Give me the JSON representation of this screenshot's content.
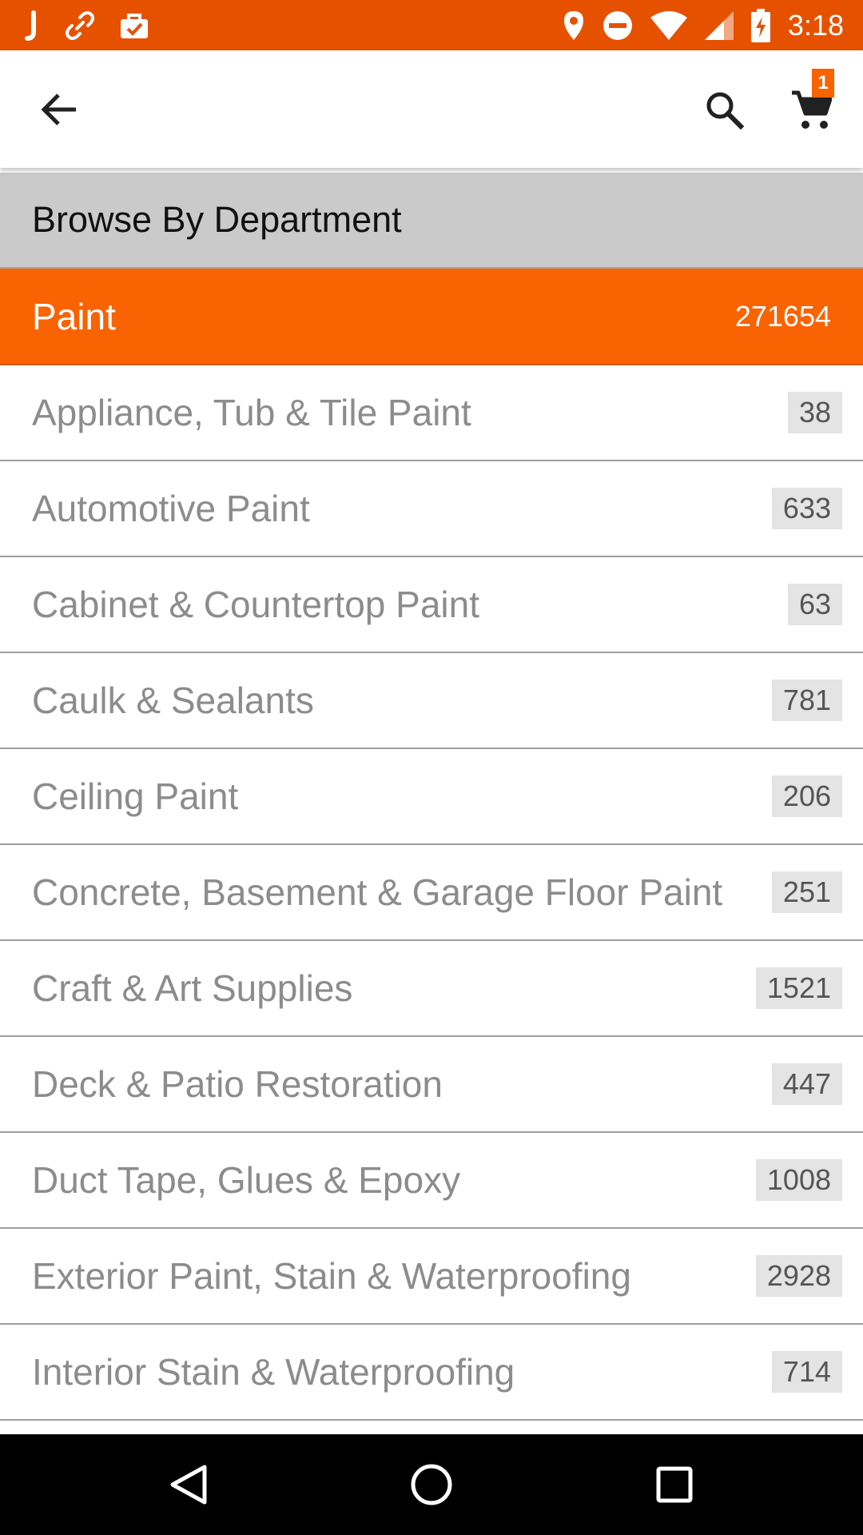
{
  "status_bar": {
    "time": "3:18",
    "left_icons": [
      "j-app-icon",
      "link-icon",
      "briefcase-check-icon"
    ],
    "right_icons": [
      "location-icon",
      "do-not-disturb-icon",
      "wifi-icon",
      "signal-icon",
      "battery-charging-icon"
    ],
    "color": "#e65100"
  },
  "app_bar": {
    "back_icon": "arrow-back-icon",
    "search_icon": "search-icon",
    "cart_icon": "cart-icon",
    "cart_count": "1"
  },
  "browse": {
    "title": "Browse By Department"
  },
  "selected_category": {
    "name": "Paint",
    "count": "271654",
    "color": "#f96302"
  },
  "subcategories": [
    {
      "name": "Appliance, Tub & Tile Paint",
      "count": "38"
    },
    {
      "name": "Automotive Paint",
      "count": "633"
    },
    {
      "name": "Cabinet & Countertop Paint",
      "count": "63"
    },
    {
      "name": "Caulk & Sealants",
      "count": "781"
    },
    {
      "name": "Ceiling Paint",
      "count": "206"
    },
    {
      "name": "Concrete, Basement & Garage Floor Paint",
      "count": "251"
    },
    {
      "name": "Craft & Art Supplies",
      "count": "1521"
    },
    {
      "name": "Deck & Patio Restoration",
      "count": "447"
    },
    {
      "name": "Duct Tape, Glues & Epoxy",
      "count": "1008"
    },
    {
      "name": "Exterior Paint, Stain & Waterproofing",
      "count": "2928"
    },
    {
      "name": "Interior Stain & Waterproofing",
      "count": "714"
    }
  ],
  "nav_bar": {
    "buttons": [
      "back-triangle-icon",
      "home-circle-icon",
      "recents-square-icon"
    ]
  }
}
